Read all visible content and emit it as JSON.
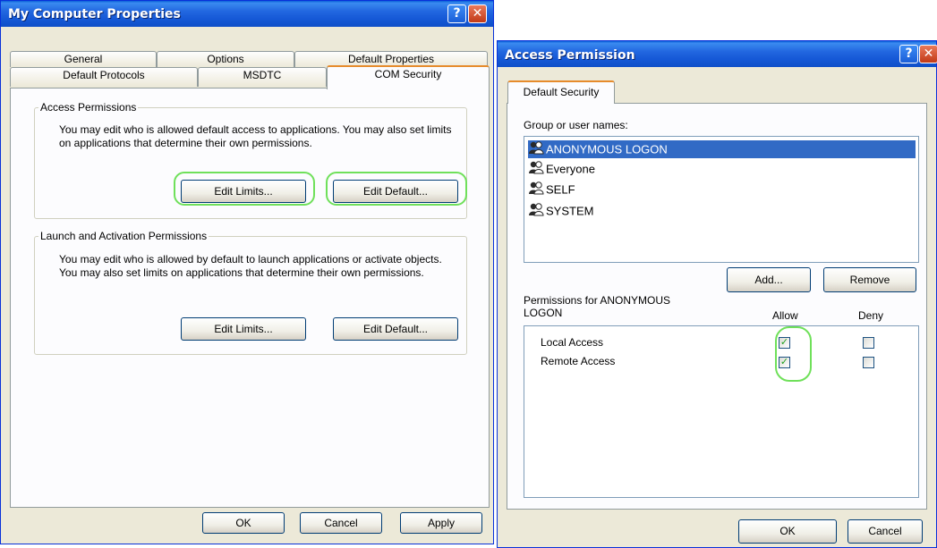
{
  "left_window": {
    "title": "My Computer Properties",
    "help_glyph": "?",
    "close_glyph": "✕",
    "tabs_top": [
      "General",
      "Options",
      "Default Properties"
    ],
    "tabs_bottom": [
      "Default Protocols",
      "MSDTC",
      "COM Security"
    ],
    "access": {
      "legend": "Access Permissions",
      "description": "You may edit who is allowed default access to applications. You may also set limits on applications that determine their own permissions.",
      "edit_limits": "Edit Limits...",
      "edit_default": "Edit Default..."
    },
    "launch": {
      "legend": "Launch and Activation Permissions",
      "description": "You may edit who is allowed by default to launch applications or activate objects. You may also set limits on applications that determine their own permissions.",
      "edit_limits": "Edit Limits...",
      "edit_default": "Edit Default..."
    },
    "ok": "OK",
    "cancel": "Cancel",
    "apply": "Apply"
  },
  "right_window": {
    "title": "Access Permission",
    "help_glyph": "?",
    "close_glyph": "✕",
    "tab": "Default Security",
    "group_label": "Group or user names:",
    "users": [
      {
        "name": "ANONYMOUS LOGON",
        "selected": true
      },
      {
        "name": "Everyone",
        "selected": false
      },
      {
        "name": "SELF",
        "selected": false
      },
      {
        "name": "SYSTEM",
        "selected": false
      }
    ],
    "add": "Add...",
    "remove": "Remove",
    "perm_label_line1": "Permissions for ANONYMOUS",
    "perm_label_line2": "LOGON",
    "allow": "Allow",
    "deny": "Deny",
    "permissions": [
      {
        "name": "Local Access",
        "allow": true,
        "deny": false
      },
      {
        "name": "Remote Access",
        "allow": true,
        "deny": false
      }
    ],
    "check_glyph": "✓",
    "ok": "OK",
    "cancel": "Cancel"
  },
  "colors": {
    "highlight": "#6fe05a",
    "selection": "#316ac5",
    "titlebar": "#1558d6"
  }
}
